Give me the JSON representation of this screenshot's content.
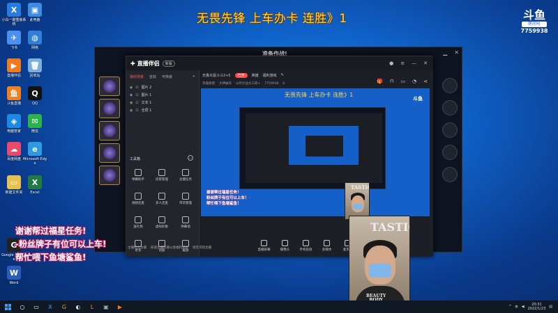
{
  "stream_title": "无畏先锋 上车办卡 连胜》1",
  "room_logo": {
    "mark": "斗鱼",
    "badge": "房间号",
    "room_number": "7759938"
  },
  "desktop_icons": [
    {
      "label": "小白一键重装系统",
      "icon": "blue-x-app-icon",
      "color": "#2a7be0",
      "glyph": "X"
    },
    {
      "label": "此电脑",
      "icon": "computer-icon",
      "color": "#3c8de0",
      "glyph": "▣"
    },
    {
      "label": "飞书",
      "icon": "feishu-icon",
      "color": "#4a90f0",
      "glyph": "✈"
    },
    {
      "label": "网络",
      "icon": "network-icon",
      "color": "#2f7fd8",
      "glyph": "◍"
    },
    {
      "label": "直播伴侣",
      "icon": "live-companion-icon",
      "color": "#f07a20",
      "glyph": "▶"
    },
    {
      "label": "回收站",
      "icon": "recycle-bin-icon",
      "color": "#7ab0e0",
      "glyph": "🗑"
    },
    {
      "label": "斗鱼直播",
      "icon": "douyu-icon",
      "color": "#f08020",
      "glyph": "鱼"
    },
    {
      "label": "QQ",
      "icon": "qq-penguin-icon",
      "color": "#111111",
      "glyph": "Q"
    },
    {
      "label": "电脑管家",
      "icon": "shield-icon",
      "color": "#1e88e5",
      "glyph": "◈"
    },
    {
      "label": "微信",
      "icon": "wechat-icon",
      "color": "#2bb24c",
      "glyph": "✉"
    },
    {
      "label": "百度网盘",
      "icon": "cloud-icon",
      "color": "#e84a6a",
      "glyph": "☁"
    },
    {
      "label": "Microsoft Edge",
      "icon": "edge-browser-icon",
      "color": "#2e9ae0",
      "glyph": "e"
    },
    {
      "label": "新建文件夹",
      "icon": "folder-icon",
      "color": "#e8c050",
      "glyph": "▭"
    },
    {
      "label": "Excel",
      "icon": "excel-icon",
      "color": "#1f7a43",
      "glyph": "X"
    },
    {
      "label": "Google Chrome",
      "icon": "chrome-icon",
      "color": "#222222",
      "glyph": "G"
    },
    {
      "label": "Word",
      "icon": "word-icon",
      "color": "#2b5cb8",
      "glyph": "W"
    }
  ],
  "game_window": {
    "title": "准备作战!"
  },
  "app": {
    "name": "直播伴侣",
    "version": "新版",
    "tabs": [
      "我的场景",
      "音效",
      "可换装"
    ],
    "layers": [
      "图片 2",
      "图片 1",
      "文本 1",
      "全屏 1"
    ],
    "tools_title": "工具箱",
    "tools": [
      "弹幕助手",
      "房管管理",
      "主播任务",
      "视频连麦",
      "多人连麦",
      "带货管理",
      "送礼物",
      "虚拟形象",
      "弹幕墙",
      "更多",
      "话题",
      "截图"
    ],
    "bottom_links": [
      "主播抢占注播",
      "知道主播开通公会福利说明",
      "语音识别主播"
    ],
    "info": {
      "room_name": "无畏大鼠斗斗2+5",
      "tag": "已开",
      "tag2": "英雄",
      "category": "福利游戏",
      "line2_a": "英雄联盟",
      "line2_b": "大神破军",
      "line2_c": "山鸡大仙大三新+",
      "line2_d": "7759938",
      "line2_e": "6"
    },
    "bottom_buttons": [
      "直播屏幕",
      "摄像头",
      "手机投屏",
      "多媒体",
      "麦克风",
      "扬声器"
    ],
    "live_button": "开始直播"
  },
  "preview": {
    "title": "无畏先锋 上车办卡 连胜》1",
    "overlay_lines": [
      "谢谢帮过福星任务！",
      "粉丝牌子有位可以上车！",
      "帮忙喂下鱼塘鲨鱼！"
    ]
  },
  "overlay_lines": [
    "谢谢帮过福星任务!",
    "-粉丝牌子有位可以上车!",
    "帮忙喂下鱼塘鲨鱼!"
  ],
  "webcam": {
    "text_top": "TASTIC",
    "text_bottom": "BEAUTY",
    "text_bottom2": "BODY"
  },
  "taskbar": {
    "time": "20:31",
    "date": "2022/1/23",
    "apps": [
      "file-explorer-icon",
      "game-app-icon",
      "chrome-icon",
      "lol-icon",
      "app-icon",
      "live-app-icon"
    ]
  }
}
